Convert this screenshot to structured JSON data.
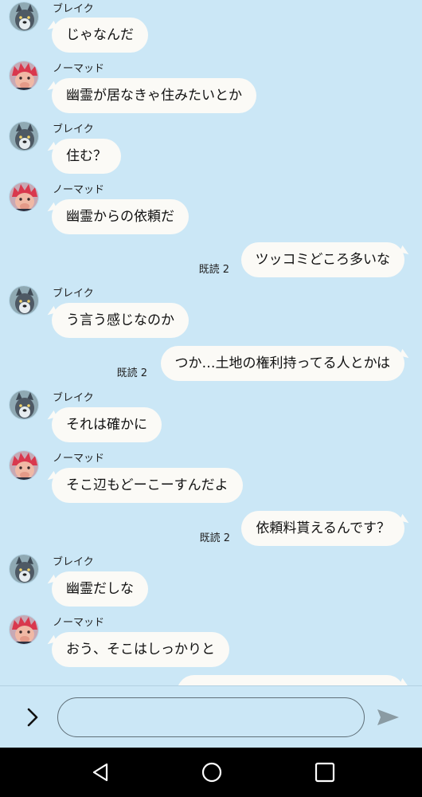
{
  "colors": {
    "background": "#cbe7f6",
    "bubble": "#fbfaf6",
    "nav_bar": "#000000"
  },
  "messages": [
    {
      "direction": "in",
      "sender": "ブレイク",
      "avatar": "wolf-avatar",
      "text": "じゃなんだ"
    },
    {
      "direction": "in",
      "sender": "ノーマッド",
      "avatar": "red-hair-avatar",
      "text": "幽霊が居なきゃ住みたいとか"
    },
    {
      "direction": "in",
      "sender": "ブレイク",
      "avatar": "wolf-avatar",
      "text": "住む？"
    },
    {
      "direction": "in",
      "sender": "ノーマッド",
      "avatar": "red-hair-avatar",
      "text": "幽霊からの依頼だ"
    },
    {
      "direction": "out",
      "text": "ツッコミどころ多いな",
      "read": "既読 2"
    },
    {
      "direction": "in",
      "sender": "ブレイク",
      "avatar": "wolf-avatar",
      "text": "う言う感じなのか"
    },
    {
      "direction": "out",
      "text": "つか…土地の権利持ってる人とかは",
      "read": "既読 2"
    },
    {
      "direction": "in",
      "sender": "ブレイク",
      "avatar": "wolf-avatar",
      "text": "それは確かに"
    },
    {
      "direction": "in",
      "sender": "ノーマッド",
      "avatar": "red-hair-avatar",
      "text": "そこ辺もどーこーすんだよ"
    },
    {
      "direction": "out",
      "text": "依頼料貰えるんです？",
      "read": "既読 2"
    },
    {
      "direction": "in",
      "sender": "ブレイク",
      "avatar": "wolf-avatar",
      "text": "幽霊だしな"
    },
    {
      "direction": "in",
      "sender": "ノーマッド",
      "avatar": "red-hair-avatar",
      "text": "おう、そこはしっかりと"
    },
    {
      "direction": "out",
      "text": ""
    }
  ],
  "input": {
    "value": "",
    "placeholder": "",
    "expand_icon": "chevron-right-icon",
    "send_icon": "send-arrow-icon"
  },
  "nav": {
    "back_icon": "back-triangle-icon",
    "home_icon": "home-circle-icon",
    "recents_icon": "recents-square-icon"
  }
}
